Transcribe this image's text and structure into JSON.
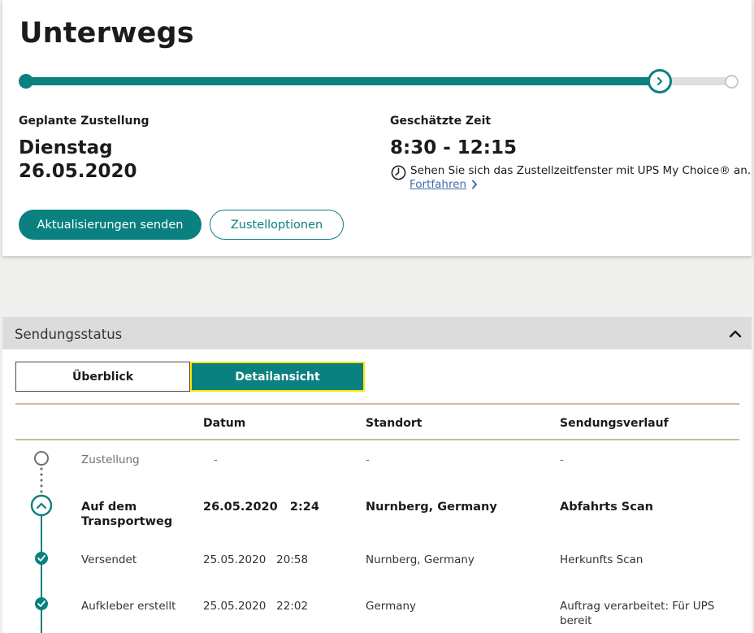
{
  "status": {
    "title": "Unterwegs",
    "progress_percent": 90,
    "planned_label": "Geplante Zustellung",
    "planned_day": "Dienstag",
    "planned_date": "26.05.2020",
    "estimated_label": "Geschätzte Zeit",
    "estimated_window": "8:30 - 12:15",
    "info_text": "Sehen Sie sich das Zustellzeitfenster mit UPS My Choice® an.",
    "continue_link": "Fortfahren",
    "send_updates_button": "Aktualisierungen senden",
    "delivery_options_button": "Zustelloptionen"
  },
  "panel": {
    "title": "Sendungsstatus",
    "tab_overview": "Überblick",
    "tab_detail": "Detailansicht",
    "columns": [
      "Datum",
      "Standort",
      "Sendungsverlauf"
    ],
    "rows": [
      {
        "status": "Zustellung",
        "date": "-",
        "location": "-",
        "activity": "-",
        "state": "pending"
      },
      {
        "status": "Auf dem Transportweg",
        "date": "26.05.2020   2:24",
        "location": "Nurnberg, Germany",
        "activity": "Abfahrts Scan",
        "state": "current"
      },
      {
        "status": "Versendet",
        "date": "25.05.2020   20:58",
        "location": "Nurnberg, Germany",
        "activity": "Herkunfts Scan",
        "state": "done"
      },
      {
        "status": "Aufkleber erstellt",
        "date": "25.05.2020   22:02",
        "location": "Germany",
        "activity": "Auftrag verarbeitet: Für UPS bereit",
        "state": "done"
      }
    ]
  },
  "colors": {
    "accent": "#0a8080",
    "focus": "#ffe800",
    "link": "#426da9",
    "page_bg": "#efefee"
  },
  "icons": {
    "progress_marker": "chevron-right-icon",
    "clock": "clock-icon",
    "collapse": "chevron-up-icon",
    "timeline_current": "chevron-up-icon",
    "timeline_done": "check-circle-icon"
  }
}
